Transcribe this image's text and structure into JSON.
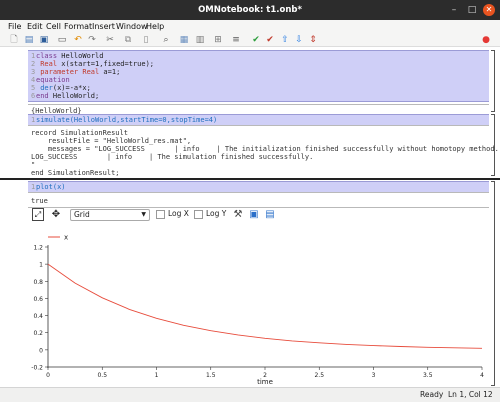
{
  "window": {
    "title": "OMNotebook: t1.onb*",
    "minimize": "–",
    "maximize": "□",
    "close": "✕"
  },
  "menu": [
    "File",
    "Edit",
    "Cell",
    "Format",
    "Insert",
    "Window",
    "Help"
  ],
  "toolbar_icons": [
    "new-file-icon",
    "open-folder-icon",
    "save-icon",
    "print-icon",
    "undo-icon",
    "redo-icon",
    "cut-icon",
    "copy-icon",
    "paste-icon",
    "search-icon",
    "replace-icon",
    "group-cell-icon",
    "insert-cell-icon",
    "align-icon",
    "eval-check-icon",
    "eval-all-icon",
    "move-up-icon",
    "move-down-icon",
    "delete-cell-icon",
    "stop-icon"
  ],
  "cells": {
    "model": {
      "lines": [
        {
          "n": "1",
          "kw": "class",
          "rest": " HelloWorld"
        },
        {
          "n": "2",
          "kw": "  Real",
          "rest": " x(start=1,fixed=true);"
        },
        {
          "n": "3",
          "kw": "  parameter Real",
          "rest": " a=1;"
        },
        {
          "n": "4",
          "kw": "equation",
          "rest": ""
        },
        {
          "n": "5",
          "kw": "  der",
          "rest": "(x)=-a*x;"
        },
        {
          "n": "6",
          "kw": "end",
          "rest": " HelloWorld;"
        }
      ],
      "output": "{HelloWorld}"
    },
    "simulate": {
      "line": {
        "n": "1",
        "text": "simulate(HelloWorld,startTime=0,stopTime=4)"
      },
      "output": "record SimulationResult\n    resultFile = \"HelloWorld_res.mat\",\n    messages = \"LOG_SUCCESS       | info    | The initialization finished successfully without homotopy method.\nLOG_SUCCESS       | info    | The simulation finished successfully.\n\"\nend SimulationResult;"
    },
    "plot": {
      "line": {
        "n": "1",
        "text": "plot(x)"
      },
      "output": "true"
    }
  },
  "plot_toolbar": {
    "grid_select": "Grid",
    "logx_label": "Log X",
    "logy_label": "Log Y",
    "icons": [
      "fit-view-icon",
      "zoom-icon",
      "settings-wrench-icon",
      "save-plot-icon",
      "print-plot-icon"
    ]
  },
  "chart_data": {
    "type": "line",
    "title": "",
    "xlabel": "time",
    "ylabel": "",
    "xlim": [
      0,
      4
    ],
    "ylim": [
      -0.2,
      1.2
    ],
    "xticks": [
      "0",
      "0.5",
      "1",
      "1.5",
      "2",
      "2.5",
      "3",
      "3.5",
      "4"
    ],
    "yticks": [
      "-0.2",
      "0",
      "0.2",
      "0.4",
      "0.6",
      "0.8",
      "1",
      "1.2"
    ],
    "legend": "top-left",
    "series": [
      {
        "name": "x",
        "color": "#e74c3c",
        "x": [
          0,
          0.25,
          0.5,
          0.75,
          1,
          1.25,
          1.5,
          1.75,
          2,
          2.25,
          2.5,
          2.75,
          3,
          3.25,
          3.5,
          3.75,
          4
        ],
        "y": [
          1,
          0.779,
          0.607,
          0.472,
          0.368,
          0.287,
          0.223,
          0.174,
          0.135,
          0.105,
          0.082,
          0.064,
          0.05,
          0.039,
          0.03,
          0.024,
          0.018
        ]
      }
    ]
  },
  "status": {
    "state": "Ready",
    "position": "Ln 1, Col 12"
  },
  "colors": {
    "titlebar": "#2c2c2c",
    "close": "#e95420",
    "input_cell": "#cfcff7",
    "series": "#e74c3c"
  }
}
